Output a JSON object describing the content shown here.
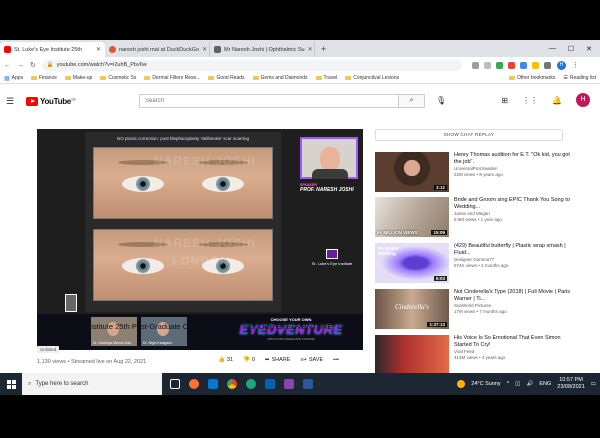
{
  "browser": {
    "tabs": [
      {
        "label": "St. Luke's Eye Institute 25th",
        "favicon_color": "#ff0000",
        "active": true
      },
      {
        "label": "naresh joshi mal at DuckDuckGo",
        "favicon_color": "#de5833",
        "active": false
      },
      {
        "label": "Mr Naresh Joshi | Ophthalmic Su",
        "favicon_color": "#5f6368",
        "active": false
      }
    ],
    "new_tab": "+",
    "url": "youtube.com/watch?v=i2uhB_Pbv6w",
    "profile_initial": "H",
    "bookmarks": [
      "Apps",
      "Finance",
      "Make-up",
      "Cosmetic Sx",
      "Dermal Fillers Rese...",
      "Good Reads",
      "Gems and Diamonds",
      "Travel",
      "Conjunctival Lesions"
    ],
    "bookmarks_right": [
      "Other bookmarks",
      "Reading list"
    ]
  },
  "youtube": {
    "logo_text": "YouTube",
    "logo_region": "GB",
    "search_placeholder": "Search",
    "avatar_initial": "H"
  },
  "video": {
    "slide_caption": "NO ptosis correction: post blepharoplasty 'deliberate' scar scarring",
    "watermark_top": "NARESH JOSHI",
    "watermark_bot": "LONDON",
    "speaker_role": "SPEAKER",
    "speaker_name": "PROF. NARESH JOSHI",
    "institute": "St. Luke's Eye Institute",
    "cam1_label": "Dr. Sandhya Menon Das",
    "cam2_label": "Dr. Nigel Kaulgaon",
    "choose": "CHOOSE YOUR OWN",
    "brand": "EYEDVENTURE",
    "brand_sub": "25TH POST-GRADUATE COURSE",
    "title": "St. Luke's Eye Institute 25th Post-Graduate Course: \"Choose Your Own EYEDVENTURE\" Day 2",
    "badge": "Unlisted",
    "meta": "1,130 views • Streamed live on Aug 22, 2021",
    "likes": "31",
    "dislikes": "0",
    "share": "SHARE",
    "save": "SAVE",
    "more": "•••"
  },
  "sidebar": {
    "chat_replay": "SHOW CHAT REPLAY",
    "recommendations": [
      {
        "title": "Henry Thomas audition for E.T. \"Ok kid, you got the job\".",
        "channel": "UniversalPicsSweden",
        "stats": "22M views • 8 years ago",
        "duration": "3:12",
        "thumb_color": "#5a3d2e"
      },
      {
        "title": "Bride and Groom sing EPIC Thank You Song to Wedding...",
        "channel": "Jamie and Megan",
        "stats": "9.6M views • 1 year ago",
        "duration": "15:09",
        "thumb_color": "#b7a89a",
        "overlay": "8+ MILLION VIEWS"
      },
      {
        "title": "(429) Beautiful butterfly | Plastic wrap smash | Fluid...",
        "channel": "Designer Gemma77",
        "stats": "574K views • 2 months ago",
        "duration": "6:03",
        "thumb_color": "#d7d3ec",
        "overlay": "No Brush Painting"
      },
      {
        "title": "Not Cinderella's Type (2018) | Full Movie | Paris Warner | Ti...",
        "channel": "SunWorld Pictures",
        "stats": "17M views • 7 months ago",
        "duration": "1:37:13",
        "thumb_color": "#8a6e5c",
        "overlay": "Cinderella's"
      },
      {
        "title": "His Voice Is So Emotional That Even Simon Started To Cry!",
        "channel": "Viral Feed",
        "stats": "414M views • 4 years ago",
        "duration": "",
        "thumb_color": "#b0302e"
      }
    ]
  },
  "taskbar": {
    "search_placeholder": "Type here to search",
    "weather": "24°C  Sunny",
    "lang": "ENG",
    "time": "10:57 PM",
    "date": "23/08/2021"
  }
}
